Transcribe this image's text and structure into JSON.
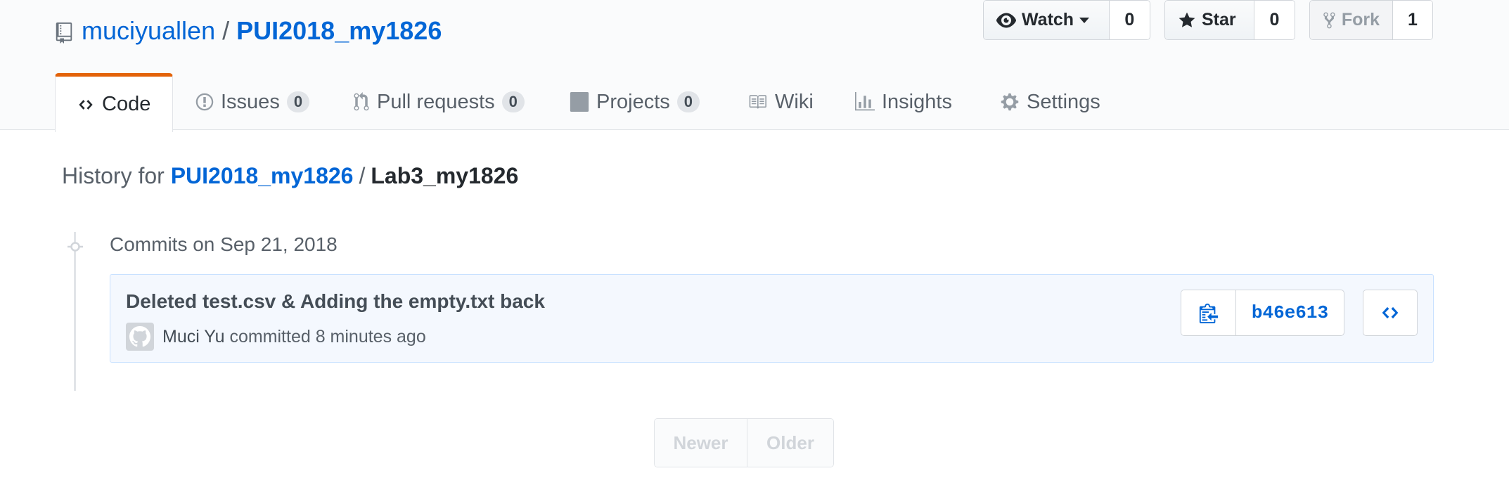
{
  "repo": {
    "owner": "muciyuallen",
    "separator": "/",
    "name": "PUI2018_my1826"
  },
  "actions": {
    "watch": {
      "label": "Watch",
      "count": "0"
    },
    "star": {
      "label": "Star",
      "count": "0"
    },
    "fork": {
      "label": "Fork",
      "count": "1"
    }
  },
  "tabs": [
    {
      "label": "Code",
      "icon": "code-icon",
      "selected": true
    },
    {
      "label": "Issues",
      "icon": "issue-icon",
      "count": "0"
    },
    {
      "label": "Pull requests",
      "icon": "pull-request-icon",
      "count": "0"
    },
    {
      "label": "Projects",
      "icon": "project-icon",
      "count": "0"
    },
    {
      "label": "Wiki",
      "icon": "book-icon"
    },
    {
      "label": "Insights",
      "icon": "graph-icon"
    },
    {
      "label": "Settings",
      "icon": "gear-icon"
    }
  ],
  "history": {
    "prefix": "History for",
    "repo_link": "PUI2018_my1826",
    "separator": "/",
    "path": "Lab3_my1826"
  },
  "commit_group": {
    "title": "Commits on Sep 21, 2018"
  },
  "commit": {
    "message": "Deleted test.csv & Adding the empty.txt back",
    "author": "Muci Yu",
    "meta": "committed 8 minutes ago",
    "sha": "b46e613"
  },
  "pagination": {
    "newer": "Newer",
    "older": "Older"
  },
  "colors": {
    "link": "#0366d6",
    "tab_accent": "#e36209",
    "commit_bg": "#f4f8fe"
  }
}
